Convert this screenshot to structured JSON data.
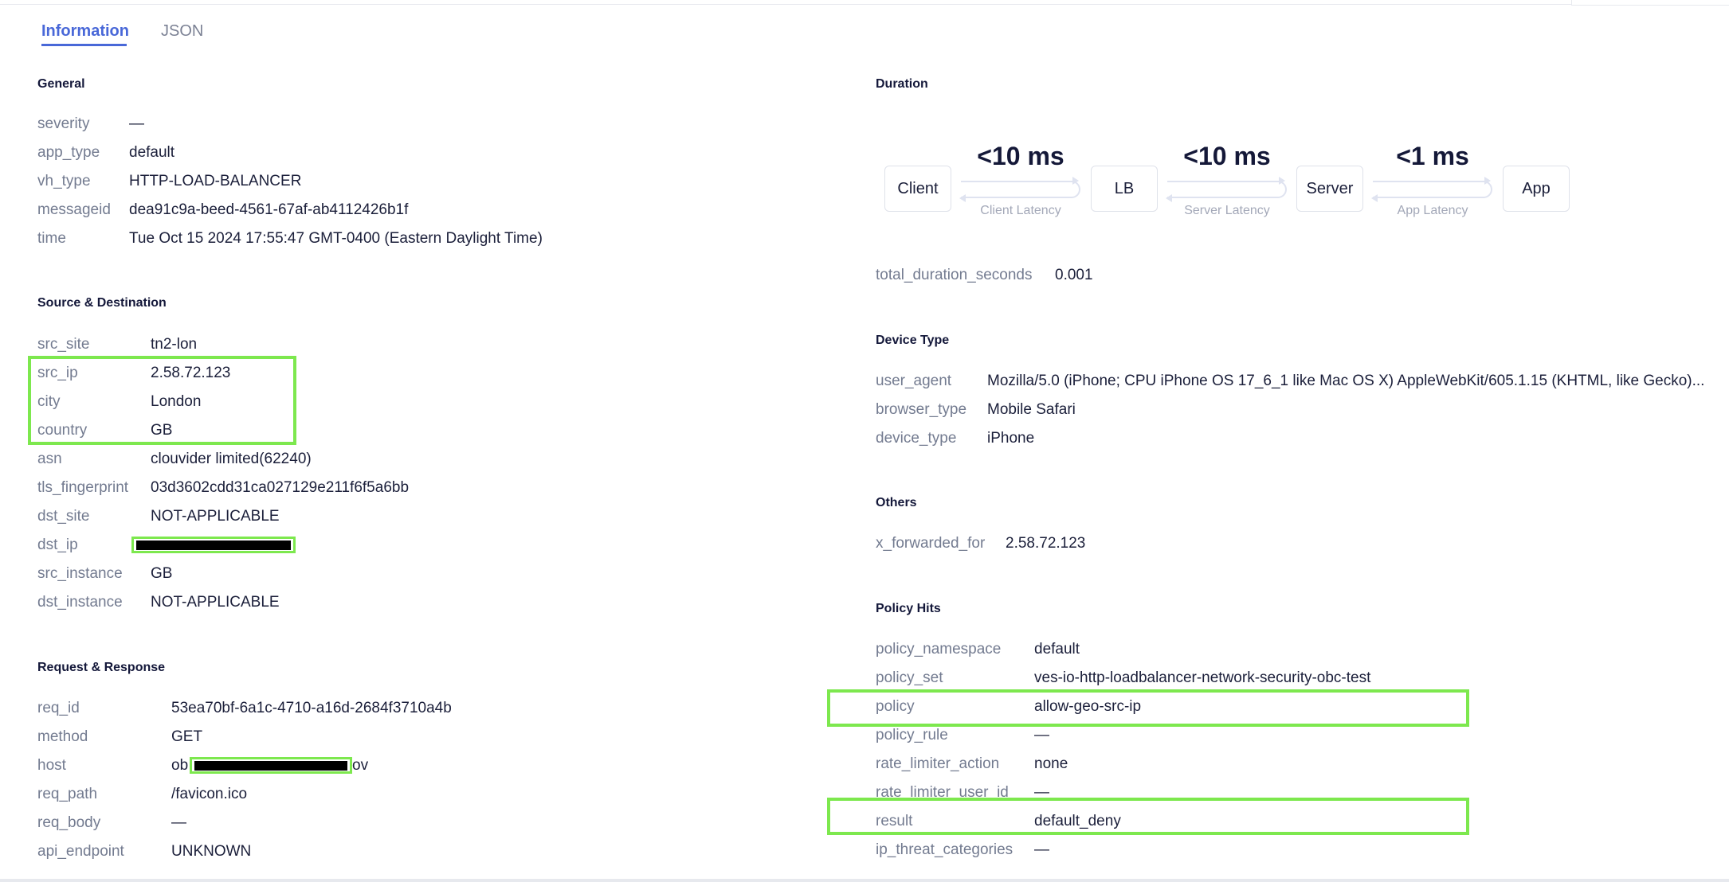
{
  "tabs": {
    "information": "Information",
    "json": "JSON"
  },
  "general": {
    "title": "General",
    "rows": [
      {
        "key": "severity",
        "value": "—"
      },
      {
        "key": "app_type",
        "value": "default"
      },
      {
        "key": "vh_type",
        "value": "HTTP-LOAD-BALANCER"
      },
      {
        "key": "messageid",
        "value": "dea91c9a-beed-4561-67af-ab4112426b1f"
      },
      {
        "key": "time",
        "value": "Tue Oct 15 2024 17:55:47 GMT-0400 (Eastern Daylight Time)"
      }
    ]
  },
  "source_destination": {
    "title": "Source & Destination",
    "rows": [
      {
        "key": "src_site",
        "value": "tn2-lon"
      },
      {
        "key": "src_ip",
        "value": "2.58.72.123"
      },
      {
        "key": "city",
        "value": "London"
      },
      {
        "key": "country",
        "value": "GB"
      },
      {
        "key": "asn",
        "value": "clouvider limited(62240)"
      },
      {
        "key": "tls_fingerprint",
        "value": "03d3602cdd31ca027129e211f6f5a6bb"
      },
      {
        "key": "dst_site",
        "value": "NOT-APPLICABLE"
      },
      {
        "key": "dst_ip",
        "value": ""
      },
      {
        "key": "src_instance",
        "value": "GB"
      },
      {
        "key": "dst_instance",
        "value": "NOT-APPLICABLE"
      }
    ]
  },
  "request_response": {
    "title": "Request & Response",
    "rows": [
      {
        "key": "req_id",
        "value": "53ea70bf-6a1c-4710-a16d-2684f3710a4b"
      },
      {
        "key": "method",
        "value": "GET"
      },
      {
        "key": "host",
        "value_prefix": "ob",
        "value_suffix": "ov"
      },
      {
        "key": "req_path",
        "value": "/favicon.ico"
      },
      {
        "key": "req_body",
        "value": "—"
      },
      {
        "key": "api_endpoint",
        "value": "UNKNOWN"
      }
    ]
  },
  "duration": {
    "title": "Duration",
    "nodes": [
      "Client",
      "LB",
      "Server",
      "App"
    ],
    "latencies": [
      {
        "value": "<10 ms",
        "label": "Client Latency"
      },
      {
        "value": "<10 ms",
        "label": "Server Latency"
      },
      {
        "value": "<1 ms",
        "label": "App Latency"
      }
    ],
    "total_key": "total_duration_seconds",
    "total_value": "0.001"
  },
  "device_type": {
    "title": "Device Type",
    "rows": [
      {
        "key": "user_agent",
        "value": "Mozilla/5.0 (iPhone; CPU iPhone OS 17_6_1 like Mac OS X) AppleWebKit/605.1.15 (KHTML, like Gecko)..."
      },
      {
        "key": "browser_type",
        "value": "Mobile Safari"
      },
      {
        "key": "device_type",
        "value": "iPhone"
      }
    ]
  },
  "others": {
    "title": "Others",
    "rows": [
      {
        "key": "x_forwarded_for",
        "value": "2.58.72.123"
      }
    ]
  },
  "policy_hits": {
    "title": "Policy Hits",
    "rows": [
      {
        "key": "policy_namespace",
        "value": "default"
      },
      {
        "key": "policy_set",
        "value": "ves-io-http-loadbalancer-network-security-obc-test"
      },
      {
        "key": "policy",
        "value": "allow-geo-src-ip"
      },
      {
        "key": "policy_rule",
        "value": "—"
      },
      {
        "key": "rate_limiter_action",
        "value": "none"
      },
      {
        "key": "rate_limiter_user_id",
        "value": "—"
      },
      {
        "key": "result",
        "value": "default_deny"
      },
      {
        "key": "ip_threat_categories",
        "value": "—"
      }
    ]
  },
  "colors": {
    "accent": "#4968d8",
    "highlight": "#7de84e",
    "redaction": "#000000"
  }
}
